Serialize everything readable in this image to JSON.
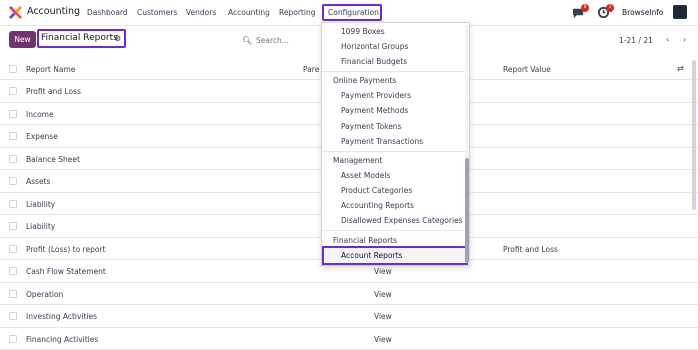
{
  "topbar": {
    "app_title": "Accounting",
    "menu": [
      "Dashboard",
      "Customers",
      "Vendors",
      "Accounting",
      "Reporting"
    ],
    "active_menu": "Configuration",
    "chat_badge": "8",
    "activity_badge": "1",
    "company": "BrowseInfo"
  },
  "control": {
    "new_label": "New",
    "breadcrumb": "Financial Reports",
    "search_placeholder": "Search...",
    "pager": "1-21 / 21"
  },
  "table": {
    "headers": {
      "name": "Report Name",
      "parent": "Pare",
      "value": "Report Value"
    },
    "rows": [
      {
        "name": "Profit and Loss",
        "parent": "",
        "value": ""
      },
      {
        "name": "Income",
        "parent": "",
        "value": ""
      },
      {
        "name": "Expense",
        "parent": "",
        "value": ""
      },
      {
        "name": "Balance Sheet",
        "parent": "",
        "value": ""
      },
      {
        "name": "Assets",
        "parent": "",
        "value": ""
      },
      {
        "name": "Liability",
        "parent": "",
        "value": ""
      },
      {
        "name": "Liability",
        "parent": "",
        "value": ""
      },
      {
        "name": "Profit (Loss) to report",
        "parent": "",
        "value": "Profit and Loss"
      },
      {
        "name": "Cash Flow Statement",
        "parent": "View",
        "value": ""
      },
      {
        "name": "Operation",
        "parent": "View",
        "value": ""
      },
      {
        "name": "Investing Activities",
        "parent": "View",
        "value": ""
      },
      {
        "name": "Financing Activities",
        "parent": "View",
        "value": ""
      }
    ]
  },
  "dropdown": {
    "items_top": [
      "1099 Boxes",
      "Horizontal Groups",
      "Financial Budgets"
    ],
    "online_payments_header": "Online Payments",
    "online_payments": [
      "Payment Providers",
      "Payment Methods",
      "Payment Tokens",
      "Payment Transactions"
    ],
    "management_header": "Management",
    "management": [
      "Asset Models",
      "Product Categories",
      "Accounting Reports",
      "Disallowed Expenses Categories"
    ],
    "financial_reports_header": "Financial Reports",
    "selected": "Account Reports"
  },
  "colors": {
    "accent": "#71346f",
    "highlight_border": "#6d28d9",
    "badge": "#dc2626"
  },
  "icons": [
    "logo-icon",
    "chat-icon",
    "activity-icon",
    "gear-icon",
    "search-icon",
    "chevron-left-icon",
    "chevron-right-icon",
    "column-options-icon"
  ]
}
